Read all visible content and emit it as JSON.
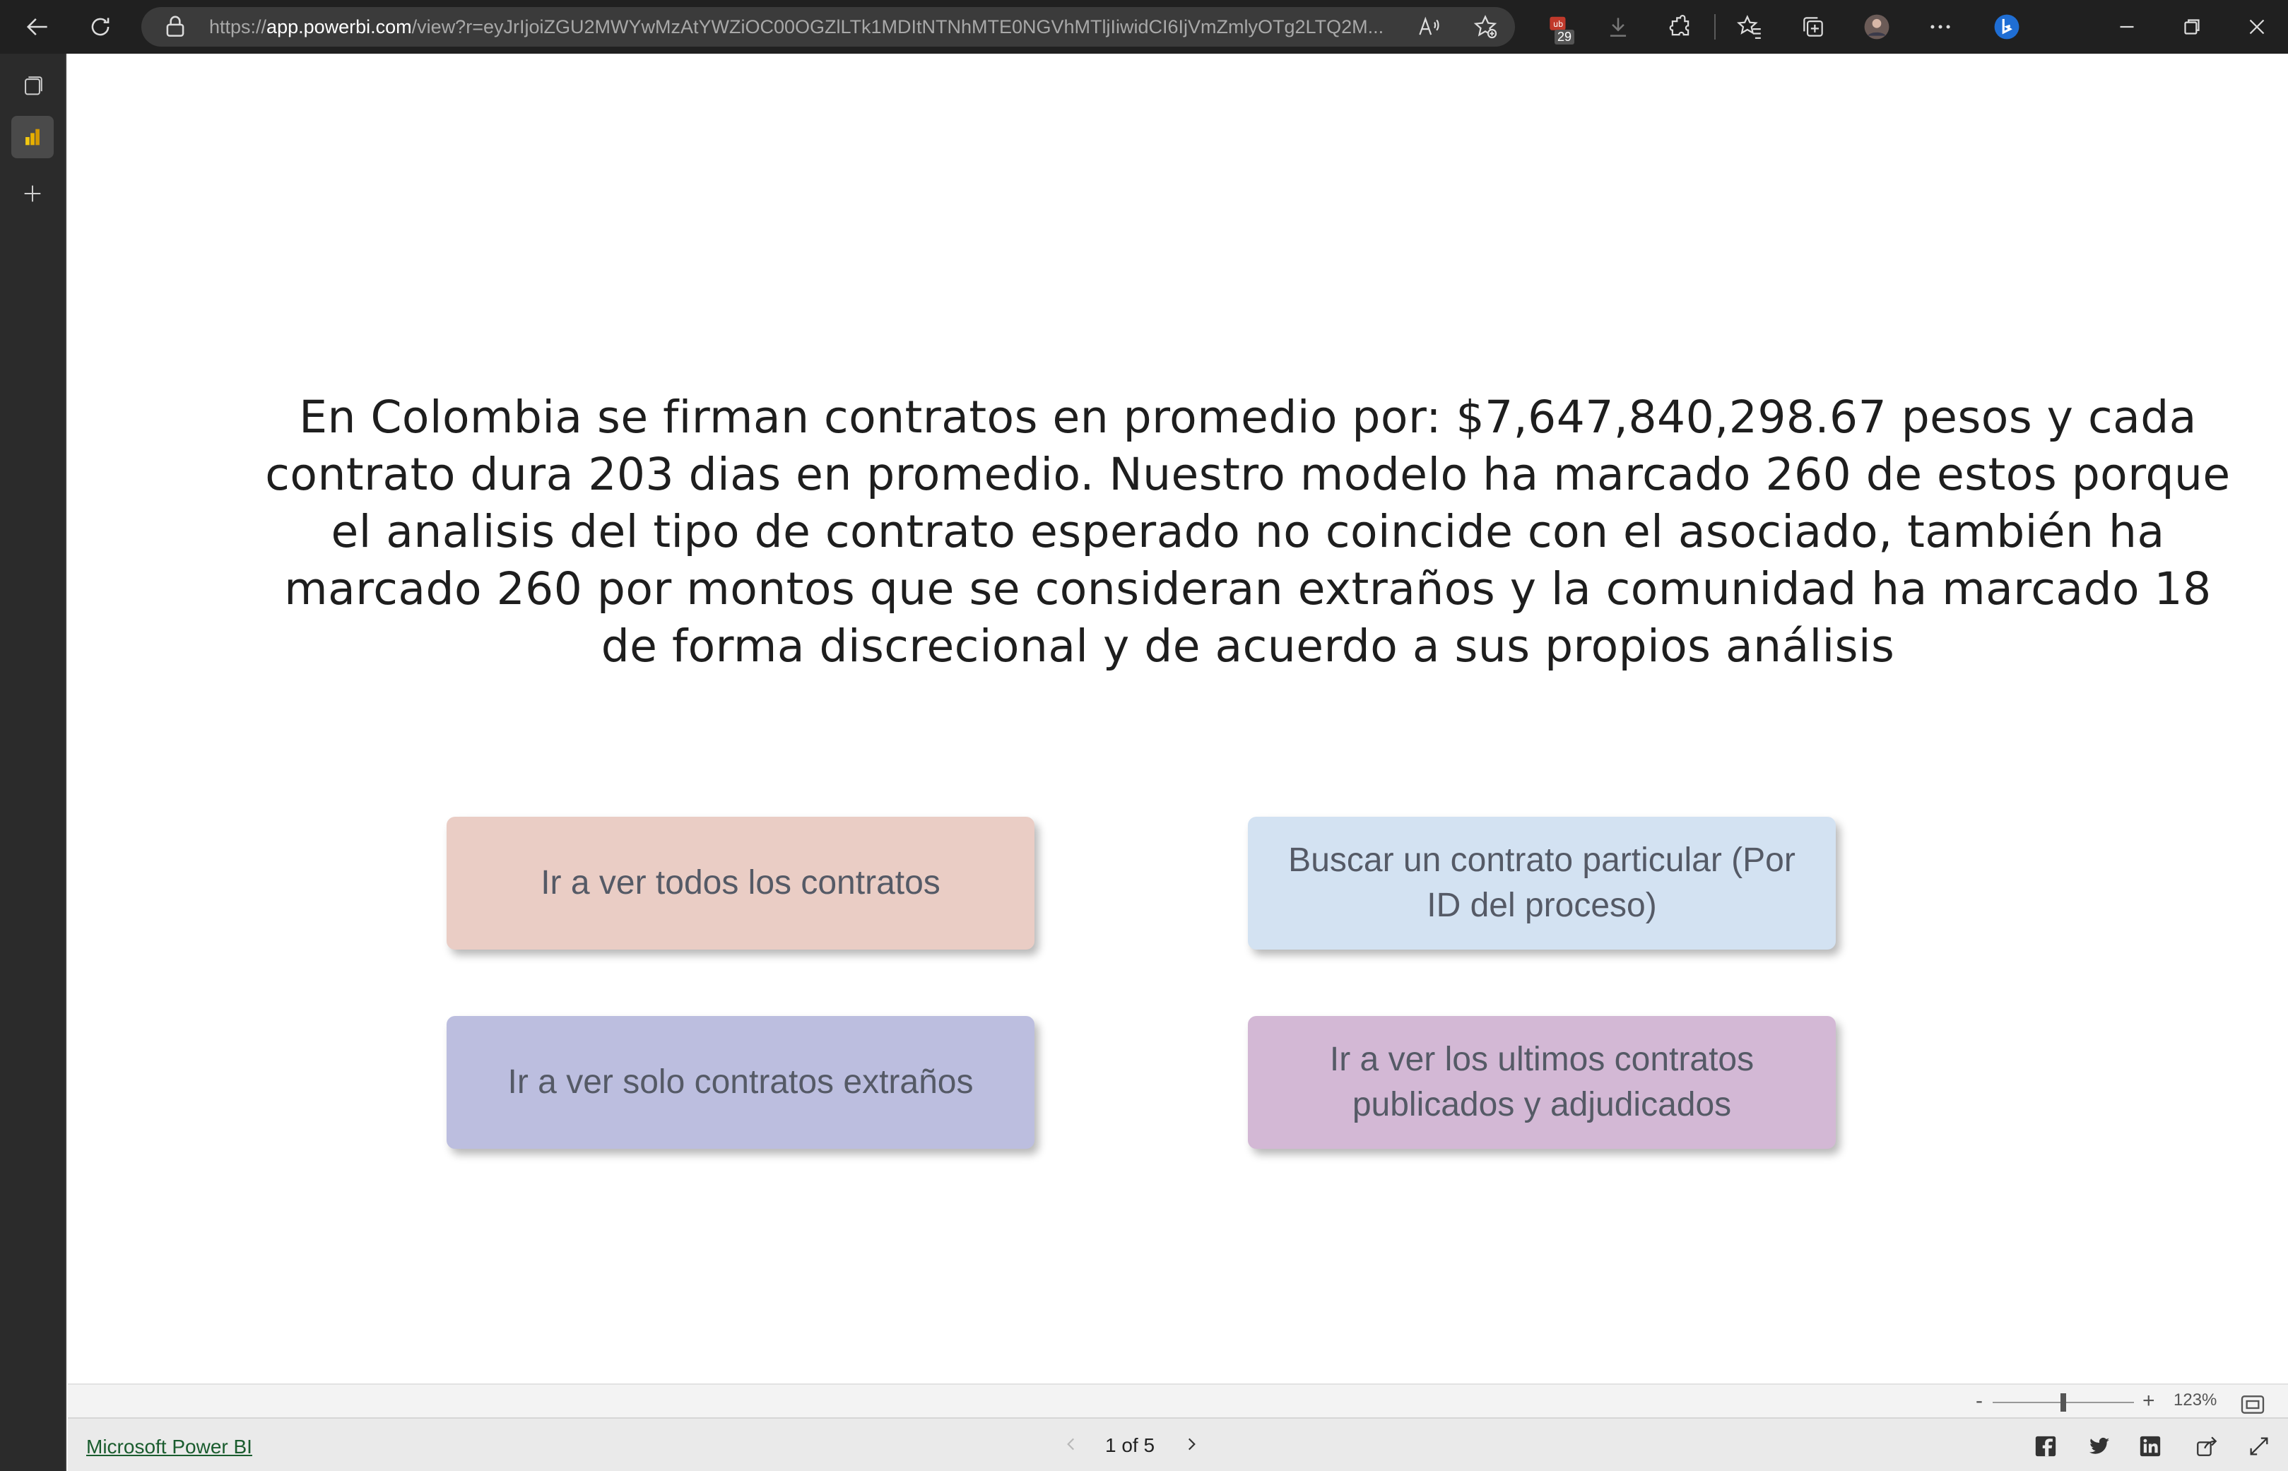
{
  "browser": {
    "url_host": "app.powerbi.com",
    "url_prefix": "https://",
    "url_rest": "/view?r=eyJrIjoiZGU2MWYwMzAtYWZiOC00OGZlLTk1MDItNTNhMTE0NGVhMTljIiwidCI6IjVmZmlyOTg2LTQ2M...",
    "extension_badge": "29"
  },
  "report": {
    "headline": "En Colombia se firman contratos en promedio por: $7,647,840,298.67 pesos y cada contrato dura 203 dias en promedio. Nuestro modelo ha marcado 260 de estos porque el analisis del tipo de contrato esperado no coincide con el asociado, también ha marcado 260 por montos que se consideran extraños y la comunidad ha marcado 18 de forma discrecional y de acuerdo a sus propios análisis",
    "buttons": {
      "all_contracts": "Ir a ver todos los contratos",
      "search_contract": "Buscar un contrato particular (Por ID del proceso)",
      "strange_contracts": "Ir a ver solo contratos extraños",
      "latest_contracts": "Ir a ver los ultimos contratos publicados y adjudicados"
    },
    "colors": {
      "all_contracts": "#eacdc5",
      "search_contract": "#d3e2f2",
      "strange_contracts": "#bcbedf",
      "latest_contracts": "#d3b8d5"
    }
  },
  "zoom": {
    "minus": "-",
    "plus": "+",
    "value": "123%",
    "level_fraction": 0.5
  },
  "footer": {
    "brand_link": "Microsoft Power BI",
    "page_indicator": "1 of 5"
  },
  "icons": [
    "back-icon",
    "refresh-icon",
    "lock-icon",
    "read-aloud-icon",
    "favorite-add-icon",
    "extension-icon",
    "download-icon",
    "puzzle-icon",
    "favorites-icon",
    "collections-icon",
    "profile-avatar",
    "more-icon",
    "bing-icon",
    "minimize-icon",
    "restore-icon",
    "close-icon",
    "tab-actions-icon",
    "powerbi-tab-icon",
    "new-tab-icon",
    "facebook-icon",
    "twitter-icon",
    "linkedin-icon",
    "share-icon",
    "fullscreen-icon"
  ]
}
